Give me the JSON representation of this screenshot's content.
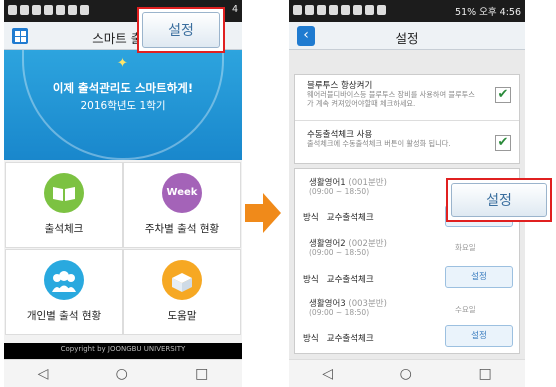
{
  "left_screen": {
    "status_right": "4",
    "title": "스마트 출석",
    "hero_line1": "이제 출석관리도 스마트하게!",
    "hero_line2": "2016학년도 1학기",
    "menu": [
      {
        "label": "출석체크",
        "icon": "book-icon"
      },
      {
        "label": "주차별 출석 현황",
        "icon": "week-calendar-icon",
        "icon_text": "Week"
      },
      {
        "label": "개인별 출석 현황",
        "icon": "people-icon"
      },
      {
        "label": "도움말",
        "icon": "help-box-icon"
      }
    ],
    "copyright": "Copyright by JOONGBU UNIVERSITY"
  },
  "left_callout": "설정",
  "right_screen": {
    "status_right": "51% 오후 4:56",
    "title": "설정",
    "settings": [
      {
        "title": "블루투스 항상켜기",
        "desc": "웨어러블디바이스등 블루투스 장비를 사용하여 블루투스가 계속 켜져있어야할때 체크하세요.",
        "checked": "✔"
      },
      {
        "title": "수동출석체크 사용",
        "desc": "출석체크에 수동출석체크 버튼이 활성화 됩니다.",
        "checked": "✔"
      }
    ],
    "classes": [
      {
        "name": "생활영어1",
        "code": "(001분반)",
        "time": "(09:00 ~ 18:50)",
        "method_label": "방식",
        "method": "교수출석체크",
        "day": "",
        "button": ""
      },
      {
        "name": "생활영어2",
        "code": "(002분반)",
        "time": "(09:00 ~ 18:50)",
        "method_label": "방식",
        "method": "교수출석체크",
        "day": "화요일",
        "button": "설정"
      },
      {
        "name": "생활영어3",
        "code": "(003분반)",
        "time": "(09:00 ~ 18:50)",
        "method_label": "방식",
        "method": "교수출석체크",
        "day": "수요일",
        "button": "설정"
      }
    ]
  },
  "right_callout": "설정",
  "nav": {
    "back": "◁",
    "home": "○",
    "recent": "□"
  },
  "colors": {
    "accent": "#1f7bd0",
    "callout_border": "#e02020",
    "arrow": "#f08a1a"
  }
}
